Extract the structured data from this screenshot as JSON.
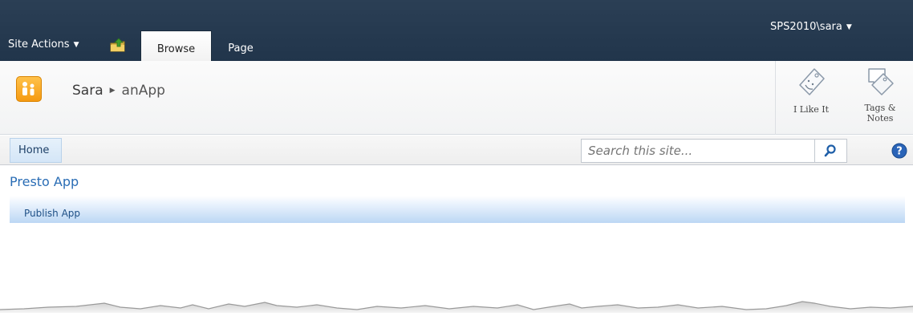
{
  "ribbon": {
    "site_actions_label": "Site Actions",
    "tabs": [
      {
        "label": "Browse",
        "selected": true
      },
      {
        "label": "Page",
        "selected": false
      }
    ],
    "user_label": "SPS2010\\sara",
    "icons": {
      "site_actions_caret": "caret-down",
      "navigate_up": "folder-up-arrow-icon",
      "user_caret": "caret-down"
    }
  },
  "title_area": {
    "breadcrumb": {
      "site": "Sara",
      "page": "anApp"
    },
    "social": [
      {
        "label_line1": "I Like It",
        "label_line2": "",
        "icon": "tag-smile-icon"
      },
      {
        "label_line1": "Tags &",
        "label_line2": "Notes",
        "icon": "tag-note-icon"
      }
    ]
  },
  "topnav": {
    "home_label": "Home",
    "search_placeholder": "Search this site...",
    "search_icon": "magnifier-icon",
    "help_icon": "question-mark-icon"
  },
  "content": {
    "title": "Presto App",
    "quick_links": [
      {
        "label": "Publish App"
      }
    ]
  },
  "colors": {
    "ribbon_bg": "#21354b",
    "link_blue": "#2a6db5",
    "quick_bar": "#bcd7f4",
    "logo_orange": "#f59a12"
  }
}
